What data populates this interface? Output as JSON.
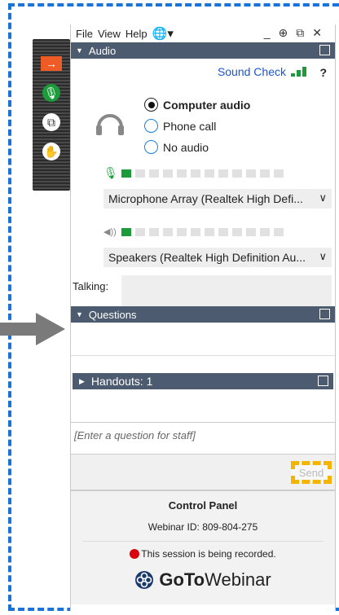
{
  "menu": {
    "items": [
      "File",
      "View",
      "Help"
    ],
    "globe": "globe-icon"
  },
  "window_controls": [
    "minimize-icon",
    "pin-icon",
    "popout-icon",
    "close-icon"
  ],
  "audio": {
    "header": "Audio",
    "sound_check": "Sound Check",
    "help": "?",
    "options": [
      {
        "label": "Computer audio",
        "selected": true
      },
      {
        "label": "Phone call",
        "selected": false
      },
      {
        "label": "No audio",
        "selected": false
      }
    ],
    "mic_level": 0.08,
    "speaker_level": 0.08,
    "microphone": "Microphone Array (Realtek High Defi...",
    "speakers": "Speakers (Realtek High Definition Au...",
    "talking_label": "Talking:"
  },
  "questions": {
    "header": "Questions"
  },
  "handouts": {
    "header": "Handouts: 1"
  },
  "question_input": {
    "placeholder": "[Enter a question for staff]"
  },
  "send_label": "Send",
  "control_panel": {
    "title": "Control Panel",
    "webinar_id": "Webinar ID: 809-804-275",
    "recording": "This session is being recorded.",
    "brand_bold": "GoTo",
    "brand_rest": "Webinar"
  },
  "colors": {
    "accent": "#1a73d9",
    "header": "#4d5b70",
    "level_on": "#1c9b3a",
    "highlight": "#f5b400",
    "record": "#d8000c"
  }
}
